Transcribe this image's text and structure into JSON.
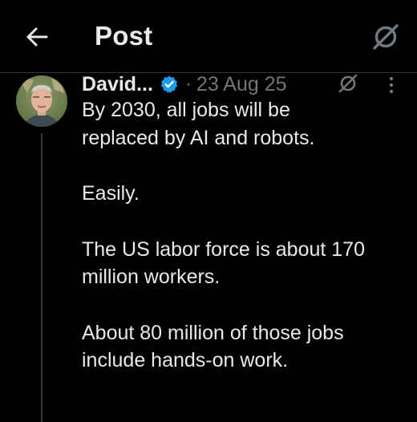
{
  "header": {
    "title": "Post",
    "back_icon": "arrow-left-icon",
    "grok_icon": "grok-icon"
  },
  "post": {
    "author_name": "David...",
    "verified": true,
    "separator": "·",
    "date": "23 Aug 25",
    "body_lines": [
      "By 2030, all jobs will be",
      "replaced by AI and robots.",
      "Easily.",
      "The US labor force is about 170",
      "million workers.",
      "About 80 million of those jobs",
      "include hands-on work."
    ]
  },
  "colors": {
    "background": "#000000",
    "text": "#e7e9ea",
    "muted": "#71767b",
    "verified_blue": "#1d9bf0",
    "divider": "#2f3336"
  }
}
